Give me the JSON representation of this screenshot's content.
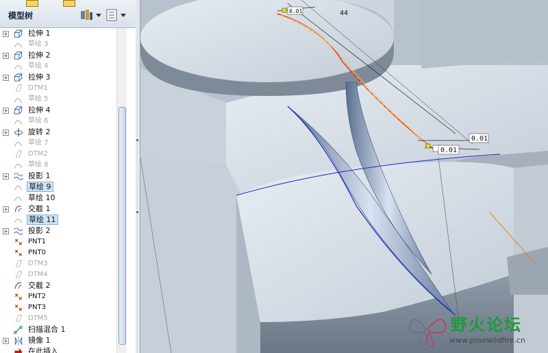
{
  "model_tree": {
    "title": "模型树",
    "settings_icon": "tools-icon",
    "show_icon": "list-icon",
    "items": [
      {
        "label": "拉伸 1",
        "icon": "extrude-icon",
        "state": "normal",
        "expander": true
      },
      {
        "label": "草绘 3",
        "icon": "sketch-icon",
        "state": "dim",
        "expander": false
      },
      {
        "label": "拉伸 2",
        "icon": "extrude-icon",
        "state": "normal",
        "expander": true
      },
      {
        "label": "草绘 4",
        "icon": "sketch-icon",
        "state": "dim",
        "expander": false
      },
      {
        "label": "拉伸 3",
        "icon": "extrude-icon",
        "state": "normal",
        "expander": true
      },
      {
        "label": "DTM1",
        "icon": "datum-plane-icon",
        "state": "dim",
        "expander": false
      },
      {
        "label": "草绘 5",
        "icon": "sketch-icon",
        "state": "dim",
        "expander": false
      },
      {
        "label": "拉伸 4",
        "icon": "extrude-icon",
        "state": "normal",
        "expander": true
      },
      {
        "label": "草绘 6",
        "icon": "sketch-icon",
        "state": "dim",
        "expander": false
      },
      {
        "label": "旋转 2",
        "icon": "revolve-icon",
        "state": "normal",
        "expander": true
      },
      {
        "label": "草绘 7",
        "icon": "sketch-icon",
        "state": "dim",
        "expander": false
      },
      {
        "label": "DTM2",
        "icon": "datum-plane-icon",
        "state": "dim",
        "expander": false
      },
      {
        "label": "草绘 8",
        "icon": "sketch-icon",
        "state": "dim",
        "expander": false
      },
      {
        "label": "投影 1",
        "icon": "projection-icon",
        "state": "normal",
        "expander": true
      },
      {
        "label": "草绘 9",
        "icon": "sketch-icon",
        "state": "selected",
        "expander": false
      },
      {
        "label": "草绘 10",
        "icon": "sketch-icon",
        "state": "normal",
        "expander": false
      },
      {
        "label": "交截 1",
        "icon": "intersect-icon",
        "state": "normal",
        "expander": true
      },
      {
        "label": "草绘 11",
        "icon": "sketch-icon",
        "state": "selected",
        "expander": false
      },
      {
        "label": "投影 2",
        "icon": "projection-icon",
        "state": "normal",
        "expander": true
      },
      {
        "label": "PNT1",
        "icon": "datum-point-icon",
        "state": "small",
        "expander": false
      },
      {
        "label": "PNT0",
        "icon": "datum-point-icon",
        "state": "small",
        "expander": false
      },
      {
        "label": "DTM3",
        "icon": "datum-plane-icon",
        "state": "dim",
        "expander": false
      },
      {
        "label": "DTM4",
        "icon": "datum-plane-icon",
        "state": "dim",
        "expander": false
      },
      {
        "label": "交截 2",
        "icon": "intersect-icon",
        "state": "normal",
        "expander": false
      },
      {
        "label": "PNT2",
        "icon": "datum-point-icon",
        "state": "small",
        "expander": false
      },
      {
        "label": "PNT3",
        "icon": "datum-point-icon",
        "state": "small",
        "expander": false
      },
      {
        "label": "DTM5",
        "icon": "datum-plane-icon",
        "state": "dim",
        "expander": false
      },
      {
        "label": "扫描混合 1",
        "icon": "swept-blend-icon",
        "state": "normal",
        "expander": false
      },
      {
        "label": "镜像 1",
        "icon": "mirror-icon",
        "state": "normal",
        "expander": true
      },
      {
        "label": "在此插入",
        "icon": "insert-here-icon",
        "state": "normal",
        "expander": false
      }
    ]
  },
  "viewport": {
    "dimensions": [
      "44",
      "0.01",
      "0.01",
      "0.01"
    ]
  },
  "watermark": {
    "title": "野火论坛",
    "url": "www.proewildfire.cn"
  },
  "colors": {
    "selection": "#cfe3f6",
    "curve_blue": "#1428c8",
    "curve_red": "#e02020",
    "curve_orange": "#ffa020",
    "watermark_green": "#1d9a3c"
  }
}
